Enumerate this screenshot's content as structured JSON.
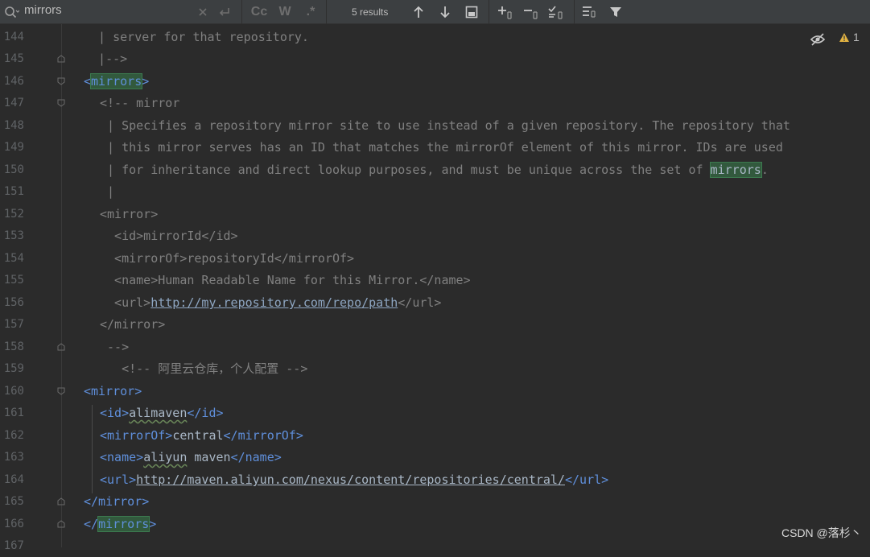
{
  "search": {
    "query": "mirrors",
    "results": "5 results"
  },
  "toolbar": {
    "match_case": "Cc",
    "words": "W",
    "regex": ".*",
    "clear_icon": "close-icon",
    "replace_icon": "replace-icon"
  },
  "inspection": {
    "warnings": "1"
  },
  "watermark": "CSDN @落杉丶",
  "colors": {
    "tag": "#5f8fdb",
    "comment": "#808080",
    "text": "#a9b7c6",
    "match": "#32593d",
    "background": "#2b2b2b"
  },
  "editor": {
    "line_numbers": [
      "144",
      "145",
      "146",
      "147",
      "148",
      "149",
      "150",
      "151",
      "152",
      "153",
      "154",
      "155",
      "156",
      "157",
      "158",
      "159",
      "160",
      "161",
      "162",
      "163",
      "164",
      "165",
      "166",
      "167"
    ],
    "lines": {
      "l144": "  | server for that repository.",
      "l145": "  |-->",
      "l147_a": "<!-- mirror",
      "l148": " | Specifies a repository mirror site to use instead of a given repository. The repository that",
      "l149": " | this mirror serves has an ID that matches the mirrorOf element of this mirror. IDs are used",
      "l150_a": " | for inheritance and direct lookup purposes, and must be unique across the set of ",
      "l150_b": ".",
      "l151": " |",
      "l152": "<mirror>",
      "l153": "  <id>mirrorId</id>",
      "l154": "  <mirrorOf>repositoryId</mirrorOf>",
      "l155": "  <name>Human Readable Name for this Mirror.</name>",
      "l156_a": "  <url>",
      "l156_url": "http://my.repository.com/repo/path",
      "l156_b": "</url>",
      "l157": "</mirror>",
      "l158": " -->",
      "l159": "   <!-- 阿里云仓库，个人配置 -->",
      "mirror_open": "<mirror>",
      "id_open": "<id>",
      "id_val": "alimaven",
      "id_close": "</id>",
      "mo_open": "<mirrorOf>",
      "mo_val": "central",
      "mo_close": "</mirrorOf>",
      "name_open": "<name>",
      "name_val1": "aliyun",
      "name_val2": " maven",
      "name_close": "</name>",
      "url_open": "<url>",
      "url_val": "http://maven.aliyun.com/nexus/content/repositories/central/",
      "url_close": "</url>",
      "mirror_close": "</mirror>",
      "mirrors_lt": "<",
      "mirrors_word": "mirrors",
      "mirrors_gt": ">",
      "mirrors_close_lt": "</",
      "match_word": "mirrors"
    }
  }
}
